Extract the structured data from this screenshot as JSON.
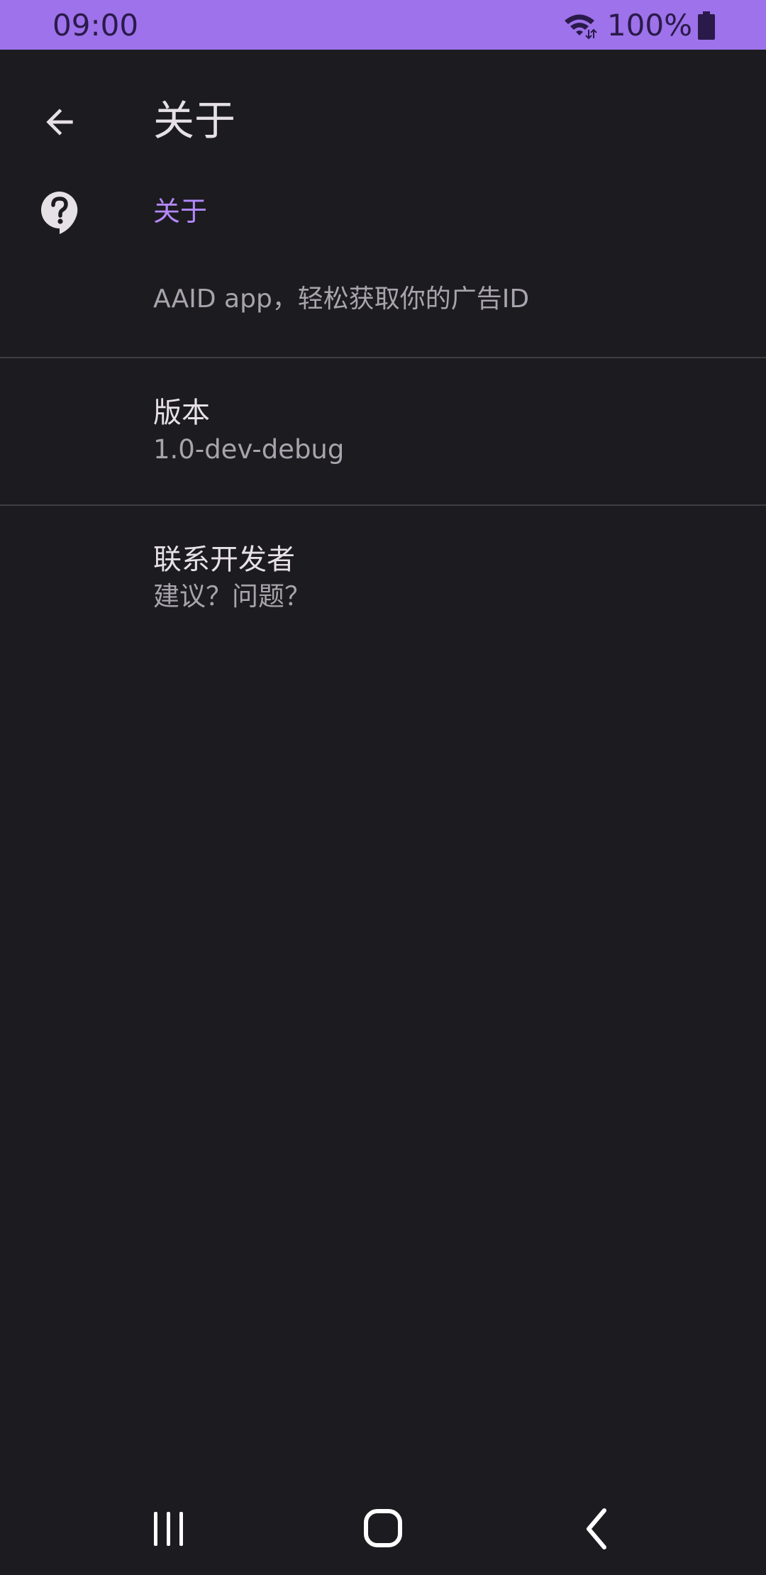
{
  "status_bar": {
    "time": "09:00",
    "battery_percent": "100%",
    "icons": [
      "wifi-icon",
      "battery-icon"
    ]
  },
  "app_bar": {
    "title": "关于",
    "back_icon": "arrow-back-icon"
  },
  "about": {
    "icon": "help-bubble-icon",
    "header": "关于",
    "description": "AAID app，轻松获取你的广告ID"
  },
  "version": {
    "title": "版本",
    "summary": "1.0-dev-debug"
  },
  "contact": {
    "title": "联系开发者",
    "summary": "建议？问题？"
  },
  "nav_bar": {
    "icons": [
      "recents-icon",
      "home-icon",
      "back-icon"
    ]
  },
  "colors": {
    "status_bar": "#9d72ea",
    "background": "#1c1b1f",
    "accent": "#b388ff",
    "primary_text": "#e6e1e5",
    "secondary_text": "#a8a4ad",
    "divider": "#3f3d43"
  }
}
